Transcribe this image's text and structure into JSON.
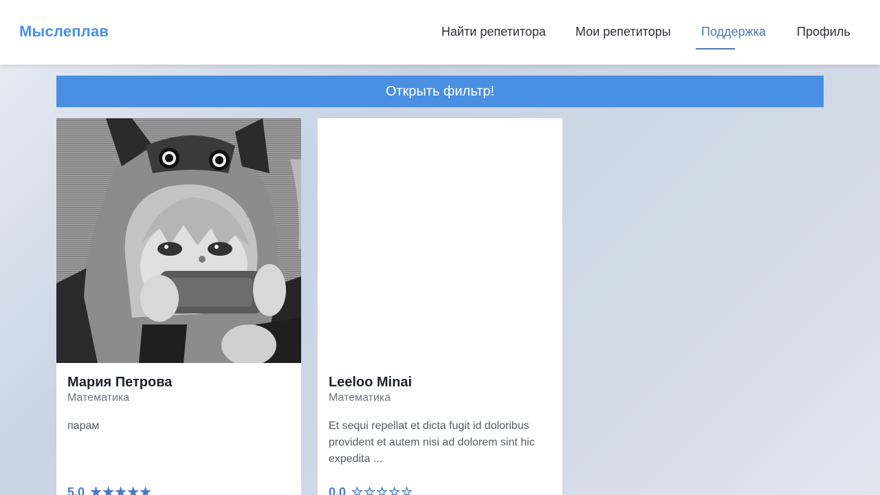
{
  "header": {
    "logo": "Мыслеплав",
    "nav": [
      {
        "label": "Найти репетитора",
        "active": false
      },
      {
        "label": "Мои репетиторы",
        "active": false
      },
      {
        "label": "Поддержка",
        "active": true
      },
      {
        "label": "Профиль",
        "active": false
      }
    ]
  },
  "filter_button": "Открыть фильтр!",
  "cards": [
    {
      "name": "Мария Петрова",
      "subject": "Математика",
      "description": "парам",
      "rating": "5.0",
      "stars": "★★★★★",
      "photo": "anime-girl-cat-hood-photo"
    },
    {
      "name": "Leeloo Minai",
      "subject": "Математика",
      "description": "Et sequi repellat et dicta fugit id doloribus provident et autem nisi ad dolorem sint hic expedita ...",
      "rating": "0.0",
      "stars": "☆☆☆☆☆",
      "photo": ""
    }
  ],
  "colors": {
    "accent": "#4a90e2",
    "active_nav": "#4a78b0",
    "rating": "#4a78c8"
  }
}
